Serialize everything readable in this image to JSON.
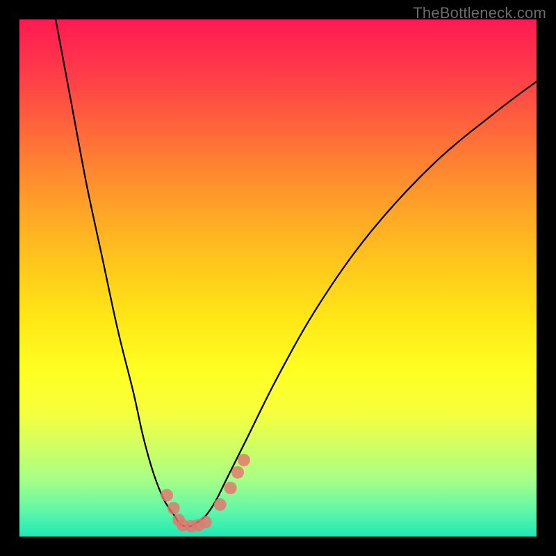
{
  "watermark": "TheBottleneck.com",
  "chart_data": {
    "type": "line",
    "title": "",
    "xlabel": "",
    "ylabel": "",
    "xlim": [
      0,
      100
    ],
    "ylim": [
      0,
      100
    ],
    "grid": false,
    "legend": false,
    "series": [
      {
        "name": "bottleneck-curve",
        "color": "#000000",
        "x": [
          7,
          10,
          13,
          16,
          19,
          22,
          24,
          26,
          28,
          30,
          31,
          32,
          33,
          34,
          36,
          38,
          40,
          44,
          50,
          58,
          68,
          80,
          92,
          100
        ],
        "y": [
          100,
          84,
          68,
          54,
          40,
          28,
          19,
          12,
          7,
          4,
          2.5,
          2,
          2,
          2.5,
          4,
          7,
          11,
          19,
          31,
          45,
          59,
          72,
          82,
          88
        ]
      }
    ],
    "markers": [
      {
        "name": "marker-cluster-left",
        "color": "#e8746c",
        "points": [
          {
            "x": 28.5,
            "y": 8.0
          },
          {
            "x": 29.8,
            "y": 5.5
          },
          {
            "x": 30.8,
            "y": 3.2
          },
          {
            "x": 31.6,
            "y": 2.2
          },
          {
            "x": 33.2,
            "y": 2.0
          },
          {
            "x": 34.6,
            "y": 2.2
          },
          {
            "x": 36.0,
            "y": 2.8
          }
        ]
      },
      {
        "name": "marker-cluster-right",
        "color": "#e8746c",
        "points": [
          {
            "x": 38.8,
            "y": 6.2
          },
          {
            "x": 40.8,
            "y": 9.4
          },
          {
            "x": 42.2,
            "y": 12.4
          },
          {
            "x": 43.4,
            "y": 14.8
          }
        ]
      }
    ]
  }
}
